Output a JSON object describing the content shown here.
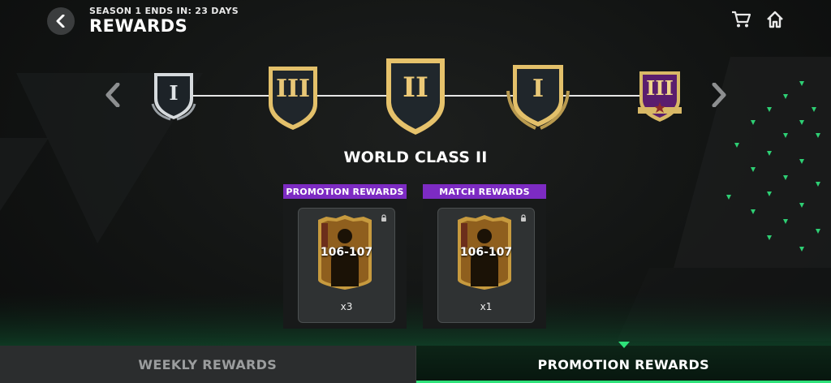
{
  "header": {
    "subtitle": "SEASON 1 ENDS IN: 23 DAYS",
    "title": "REWARDS",
    "back_icon": "chevron-left-icon"
  },
  "top_icons": [
    "cart-icon",
    "home-icon"
  ],
  "tiers": [
    {
      "numeral": "I",
      "style": "silver"
    },
    {
      "numeral": "III",
      "style": "gold"
    },
    {
      "numeral": "II",
      "style": "gold-selected"
    },
    {
      "numeral": "I",
      "style": "gold-laurel"
    },
    {
      "numeral": "III",
      "style": "purple-star"
    }
  ],
  "selected_tier_name": "WORLD CLASS II",
  "rewards": [
    {
      "header": "PROMOTION REWARDS",
      "rating": "106-107",
      "quantity": "x3",
      "locked": true
    },
    {
      "header": "MATCH REWARDS",
      "rating": "106-107",
      "quantity": "x1",
      "locked": true
    }
  ],
  "tabs": [
    {
      "label": "WEEKLY REWARDS",
      "active": false
    },
    {
      "label": "PROMOTION REWARDS",
      "active": true
    }
  ],
  "colors": {
    "accent_purple": "#7d2bc3",
    "accent_green": "#2ee27a",
    "gold": "#d9b45a",
    "silver": "#b8bdc2"
  }
}
